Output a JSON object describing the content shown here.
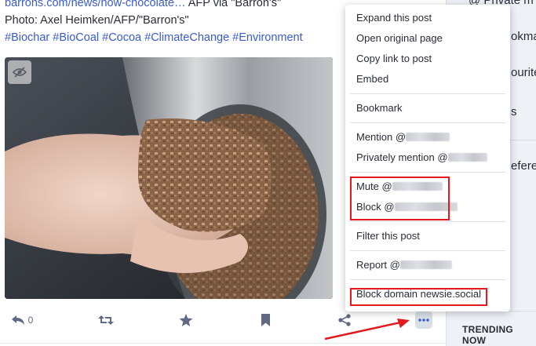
{
  "post": {
    "link_text": "barrons.com/news/how-chocolate…",
    "line1_suffix": " AFP via \"Barron's\"",
    "photo_credit": "Photo: Axel Heimken/AFP/\"Barron's\"",
    "hashtags": "#Biochar #BioCoal #Cocoa #ClimateChange #Environment"
  },
  "actions": {
    "reply_count": "0"
  },
  "menu": {
    "expand": "Expand this post",
    "open_original": "Open original page",
    "copy_link": "Copy link to post",
    "embed": "Embed",
    "bookmark": "Bookmark",
    "mention": "Mention @",
    "privately_mention": "Privately mention @",
    "mute": "Mute @",
    "block": "Block @",
    "filter": "Filter this post",
    "report": "Report @",
    "block_domain": "Block domain newsie.social"
  },
  "sidebar": {
    "item1": "@ Private m",
    "item2": "okmark",
    "item3": "ourite",
    "item4": "s",
    "item5": "eferenc",
    "trending": "TRENDING NOW"
  },
  "colors": {
    "link": "#3a5bcd",
    "highlight": "#e4191d",
    "icon": "#606984"
  }
}
